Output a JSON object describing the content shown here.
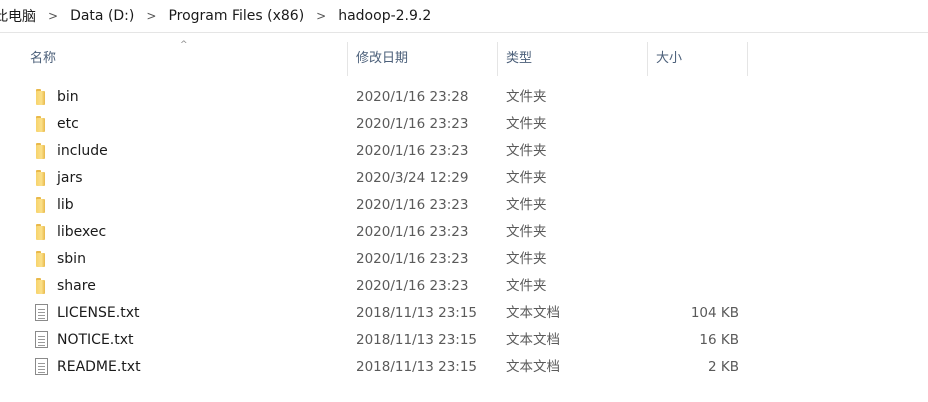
{
  "breadcrumb": [
    "此电脑",
    "Data (D:)",
    "Program Files (x86)",
    "hadoop-2.9.2"
  ],
  "breadcrumb_separator": ">",
  "sort_indicator": "^",
  "columns": {
    "name": "名称",
    "date": "修改日期",
    "type": "类型",
    "size": "大小"
  },
  "files": [
    {
      "name": "bin",
      "date": "2020/1/16 23:28",
      "type": "文件夹",
      "size": "",
      "kind": "folder"
    },
    {
      "name": "etc",
      "date": "2020/1/16 23:23",
      "type": "文件夹",
      "size": "",
      "kind": "folder"
    },
    {
      "name": "include",
      "date": "2020/1/16 23:23",
      "type": "文件夹",
      "size": "",
      "kind": "folder"
    },
    {
      "name": "jars",
      "date": "2020/3/24 12:29",
      "type": "文件夹",
      "size": "",
      "kind": "folder"
    },
    {
      "name": "lib",
      "date": "2020/1/16 23:23",
      "type": "文件夹",
      "size": "",
      "kind": "folder"
    },
    {
      "name": "libexec",
      "date": "2020/1/16 23:23",
      "type": "文件夹",
      "size": "",
      "kind": "folder"
    },
    {
      "name": "sbin",
      "date": "2020/1/16 23:23",
      "type": "文件夹",
      "size": "",
      "kind": "folder"
    },
    {
      "name": "share",
      "date": "2020/1/16 23:23",
      "type": "文件夹",
      "size": "",
      "kind": "folder"
    },
    {
      "name": "LICENSE.txt",
      "date": "2018/11/13 23:15",
      "type": "文本文档",
      "size": "104 KB",
      "kind": "text"
    },
    {
      "name": "NOTICE.txt",
      "date": "2018/11/13 23:15",
      "type": "文本文档",
      "size": "16 KB",
      "kind": "text"
    },
    {
      "name": "README.txt",
      "date": "2018/11/13 23:15",
      "type": "文本文档",
      "size": "2 KB",
      "kind": "text"
    }
  ],
  "icons": {
    "folder": "folder-icon",
    "text": "text-file-icon"
  },
  "colors": {
    "folder": "#f7d36b",
    "header_text": "#4c607a",
    "detail_text": "#5a5a5a"
  }
}
